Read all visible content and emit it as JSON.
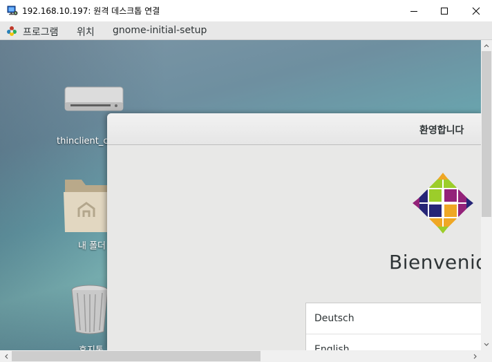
{
  "window": {
    "title": "192.168.10.197: 원격 데스크톱 연결",
    "icon": "remote-desktop-icon",
    "controls": {
      "minimize": "minimize-icon",
      "maximize": "maximize-icon",
      "close": "close-icon"
    }
  },
  "panel": {
    "apps_label": "프로그램",
    "places_label": "위치",
    "app_name": "gnome-initial-setup"
  },
  "desktop": {
    "icons": [
      {
        "label": "thinclient_c",
        "icon": "drive-icon"
      },
      {
        "label": "내 폴더",
        "icon": "home-folder-icon"
      },
      {
        "label": "휴지통",
        "icon": "trash-icon"
      }
    ]
  },
  "setup": {
    "header_title": "환영합니다",
    "welcome_text": "Bienvenid",
    "logo": "centos-logo",
    "languages": [
      "Deutsch",
      "English"
    ]
  },
  "colors": {
    "panel_bg": "#e8e8e8",
    "setup_bg": "#e8e8e7",
    "text": "#2e3436"
  }
}
